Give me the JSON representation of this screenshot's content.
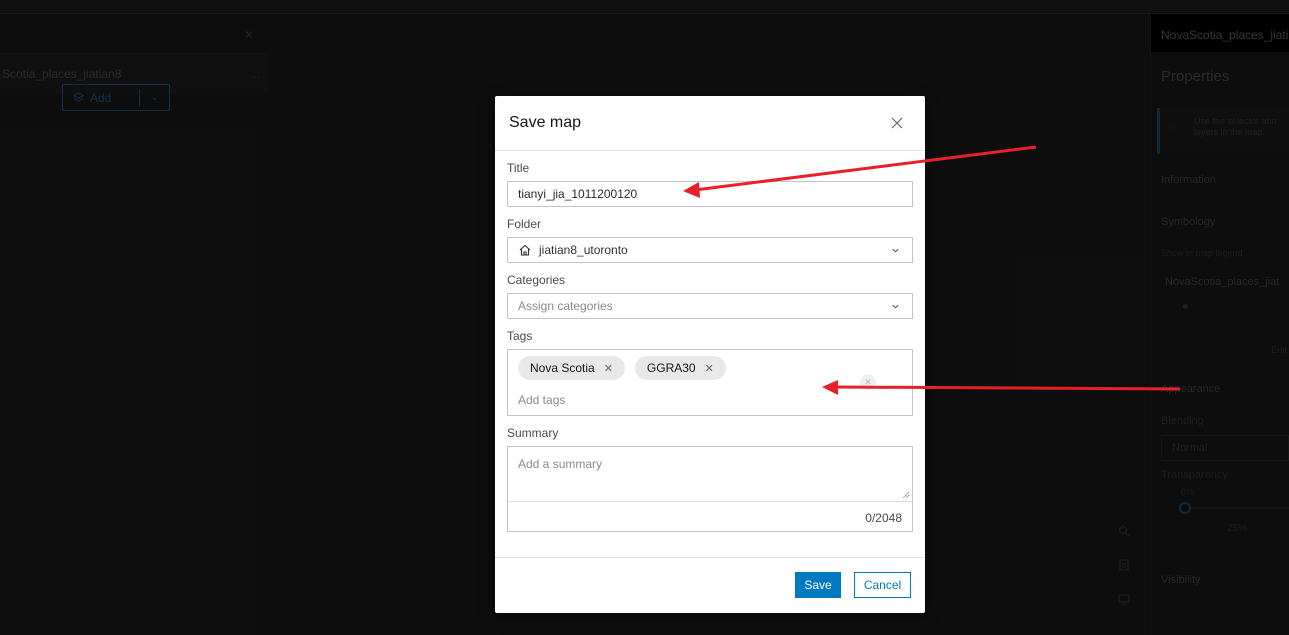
{
  "background": {
    "layers_panel": {
      "layer_name": "Scotia_places_jiatian8",
      "more_label": "...",
      "add_label": "Add"
    },
    "properties_panel": {
      "header": "NovaScotia_places_jiati",
      "title": "Properties",
      "note": "Use the selector abo layers in the map.",
      "information": "Information",
      "symbology": "Symbology",
      "legend_toggle": "Show in map legend",
      "layer_name": "NovaScotia_places_jiat",
      "edit": "Edit",
      "appearance": "Appearance",
      "blending": "Blending",
      "blending_value": "Normal",
      "transparency": "Transparency",
      "transparency_min": "0%",
      "transparency_tick": "25%",
      "visibility": "Visibility"
    }
  },
  "dialog": {
    "title": "Save map",
    "title_label": "Title",
    "title_value": "tianyi_jia_1011200120",
    "folder_label": "Folder",
    "folder_value": "jiatian8_utoronto",
    "categories_label": "Categories",
    "categories_placeholder": "Assign categories",
    "tags_label": "Tags",
    "tags": [
      {
        "label": "Nova Scotia"
      },
      {
        "label": "GGRA30"
      }
    ],
    "tags_placeholder": "Add tags",
    "summary_label": "Summary",
    "summary_placeholder": "Add a summary",
    "char_count": "0/2048",
    "save_label": "Save",
    "cancel_label": "Cancel"
  },
  "colors": {
    "accent": "#0079c1",
    "annotation_arrow": "#e8202a"
  }
}
